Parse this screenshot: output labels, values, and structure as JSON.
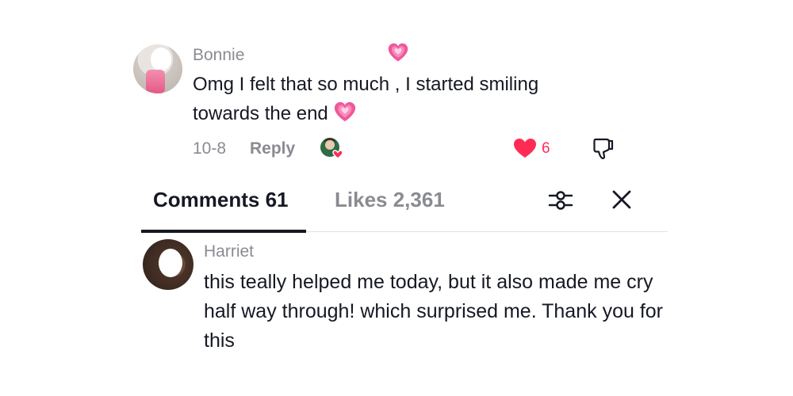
{
  "colors": {
    "accent": "#fe2c55",
    "secondary_text": "#8a8b91",
    "primary_text": "#161823"
  },
  "comment_top": {
    "username": "Bonnie",
    "text": "Omg I felt that so much , I started smiling towards the end",
    "date": "10-8",
    "reply_label": "Reply",
    "like_count": "6",
    "liked_by_creator": true,
    "icons": [
      "heart-emoji-icon",
      "creator-avatar-icon",
      "heart-icon",
      "thumbs-down-icon"
    ]
  },
  "tabs": {
    "comments_label": "Comments 61",
    "likes_label": "Likes 2,361",
    "active": "comments"
  },
  "toolbar": {
    "icons": [
      "filter-icon",
      "close-icon"
    ]
  },
  "comment_bottom": {
    "username": "Harriet",
    "text": "this teally helped me today, but it also made me cry half way through! which surprised me. Thank you for this"
  }
}
